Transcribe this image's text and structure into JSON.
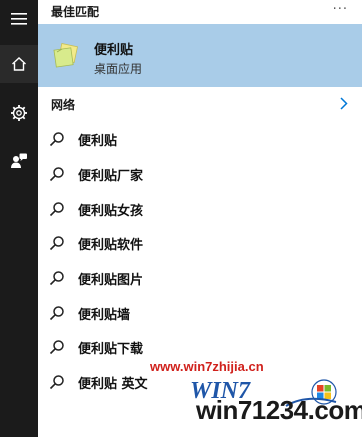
{
  "sidebar": {
    "items": [
      {
        "icon": "hamburger-menu-icon"
      },
      {
        "icon": "home-icon"
      },
      {
        "icon": "settings-gear-icon"
      },
      {
        "icon": "feedback-person-icon"
      }
    ]
  },
  "best_match": {
    "header": "最佳匹配",
    "more_label": "···",
    "app_name": "便利贴",
    "app_type": "桌面应用",
    "icon": "sticky-notes-icon",
    "highlight_color": "#a9cce8"
  },
  "web": {
    "label": "网络",
    "chevron": "chevron-right-icon",
    "accent": "#0078d7"
  },
  "results": [
    {
      "text": "便利贴"
    },
    {
      "text": "便利贴厂家"
    },
    {
      "text": "便利贴女孩"
    },
    {
      "text": "便利贴软件"
    },
    {
      "text": "便利贴图片"
    },
    {
      "text": "便利贴墙"
    },
    {
      "text": "便利贴下载"
    },
    {
      "text": "便利贴 英文"
    }
  ],
  "watermark": {
    "url": "www.win7zhijia.cn",
    "logo_text": "WIN7",
    "site": "win71234.com"
  }
}
